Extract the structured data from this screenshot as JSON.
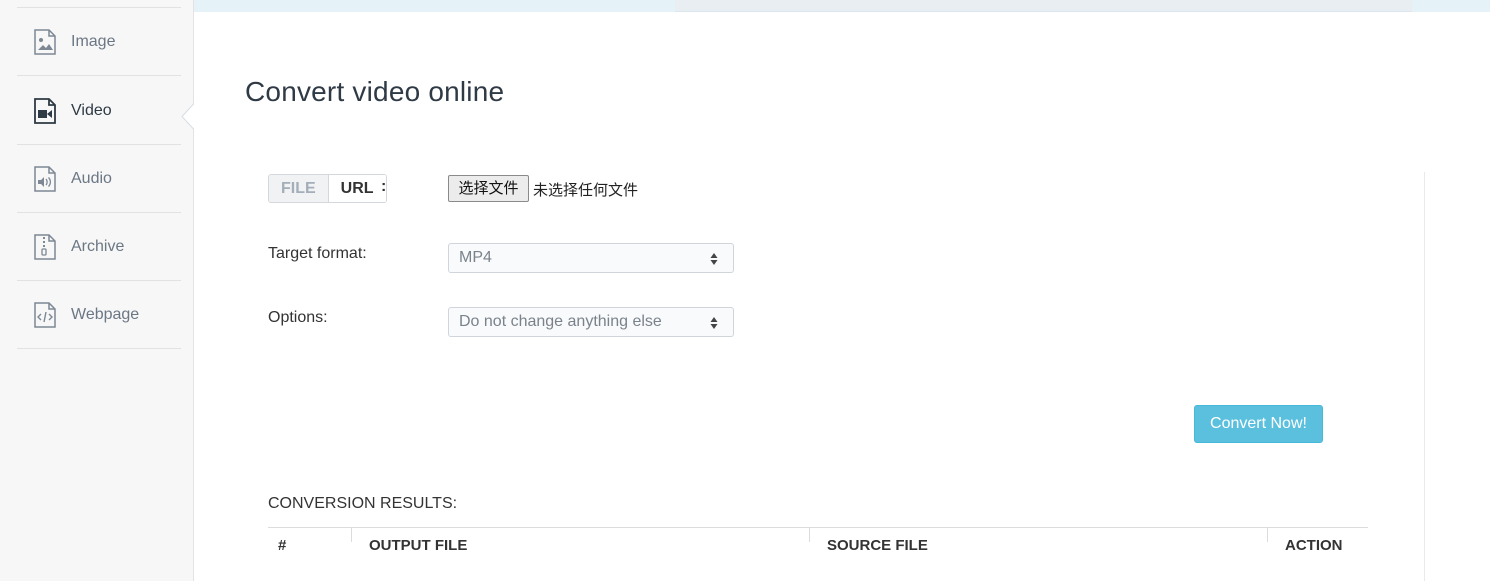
{
  "sidebar": {
    "items": [
      {
        "label": "Image",
        "icon": "image-file-icon",
        "active": false
      },
      {
        "label": "Video",
        "icon": "video-file-icon",
        "active": true
      },
      {
        "label": "Audio",
        "icon": "audio-file-icon",
        "active": false
      },
      {
        "label": "Archive",
        "icon": "archive-file-icon",
        "active": false
      },
      {
        "label": "Webpage",
        "icon": "webpage-file-icon",
        "active": false
      }
    ]
  },
  "main": {
    "title": "Convert video online",
    "source": {
      "toggle": {
        "file_label": "FILE",
        "url_label": "URL",
        "selected": "FILE"
      },
      "colon": ":",
      "file_button_label": "选择文件",
      "file_status": "未选择任何文件"
    },
    "target_format": {
      "label": "Target format:",
      "value": "MP4"
    },
    "options": {
      "label": "Options:",
      "value": "Do not change anything else"
    },
    "convert_button_label": "Convert Now!",
    "results": {
      "title": "CONVERSION RESULTS:",
      "columns": [
        "#",
        "OUTPUT FILE",
        "SOURCE FILE",
        "ACTION"
      ]
    }
  },
  "colors": {
    "accent": "#5bc0de",
    "sidebar_bg": "#f7f7f7",
    "top_strip": "#e5f2f8"
  }
}
